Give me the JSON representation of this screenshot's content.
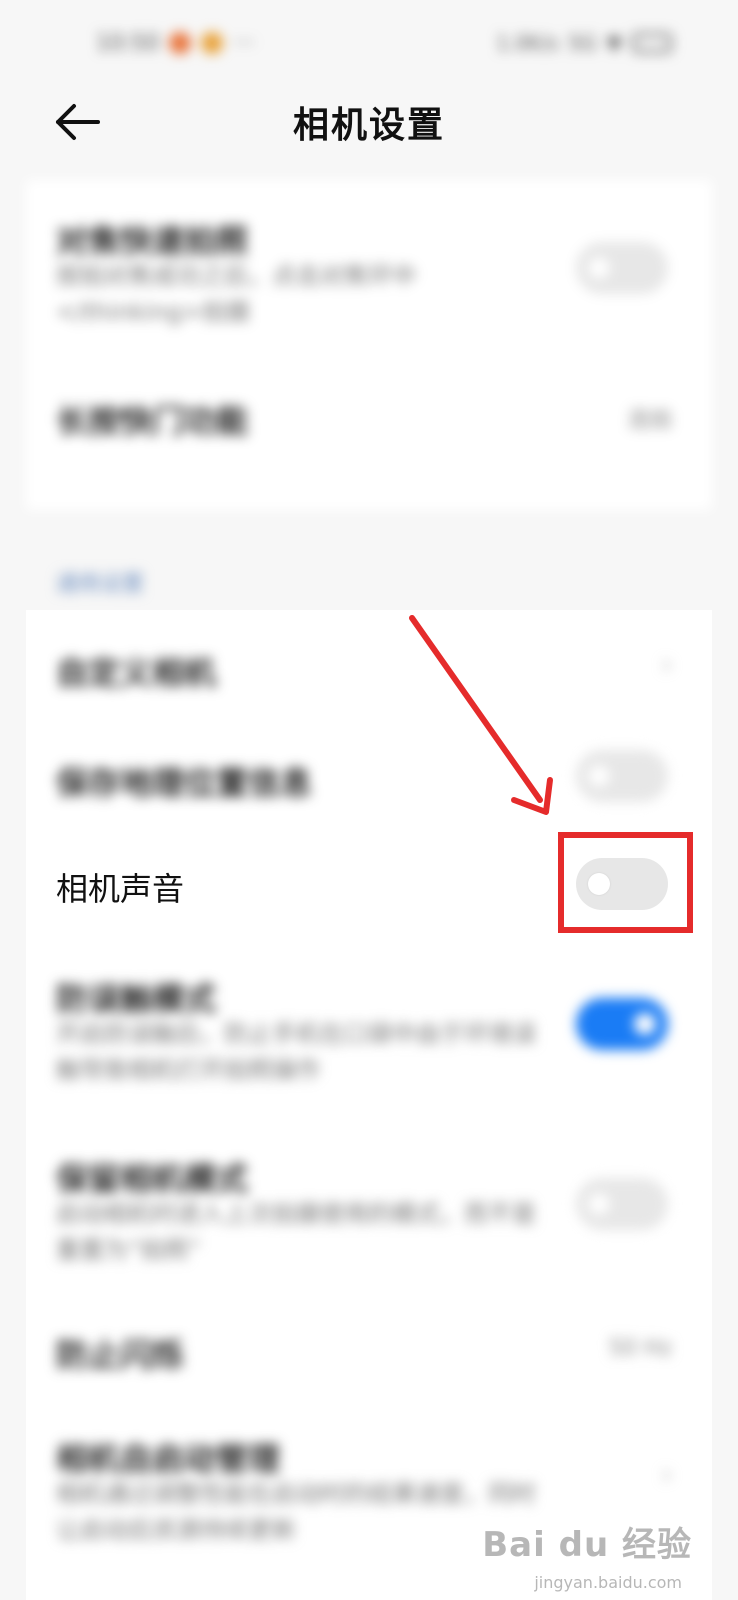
{
  "status_bar": {
    "time": "10:50",
    "network": "1.0K/s",
    "signal": "5G"
  },
  "header": {
    "back_icon": "arrow-left-icon",
    "title": "相机设置"
  },
  "settings_top": [
    {
      "title": "对焦快速拍照",
      "description": "按拍对焦成功之后，点击对焦环中</thinking>拍摄",
      "control": "toggle",
      "on": false
    },
    {
      "title": "长按快门功能",
      "value": "连拍",
      "control": "select"
    }
  ],
  "section": {
    "label": "通用设置"
  },
  "settings_main": [
    {
      "title": "自定义相机",
      "control": "chevron"
    },
    {
      "title": "保存地理位置信息",
      "control": "toggle",
      "on": false
    },
    {
      "title": "相机声音",
      "control": "toggle",
      "on": false,
      "highlighted": true
    },
    {
      "title": "防误触模式",
      "description": "开启防误触后，防止手机在口袋中由于环境误触导致相机打开拍照操作",
      "control": "toggle",
      "on": true
    },
    {
      "title": "保留相机模式",
      "description": "启动相机时进入上次拍摄使用的模式，而不是重置为“拍照”",
      "control": "toggle",
      "on": false
    },
    {
      "title": "防止闪烁",
      "value": "50 Hz",
      "control": "select"
    },
    {
      "title": "相机自启动管理",
      "description": "相机通过调整性能在启动时的结果速度，同时让启动后资源持续更新",
      "control": "chevron"
    }
  ],
  "annotation": {
    "arrow_color": "#e52b2b",
    "box_color": "#e52b2b"
  },
  "watermark": {
    "text": "Bai du 经验",
    "sub": "jingyan.baidu.com"
  },
  "colors": {
    "accent": "#1a7cf5",
    "toggle_off": "#e7e7e7",
    "background": "#f7f7f7"
  }
}
